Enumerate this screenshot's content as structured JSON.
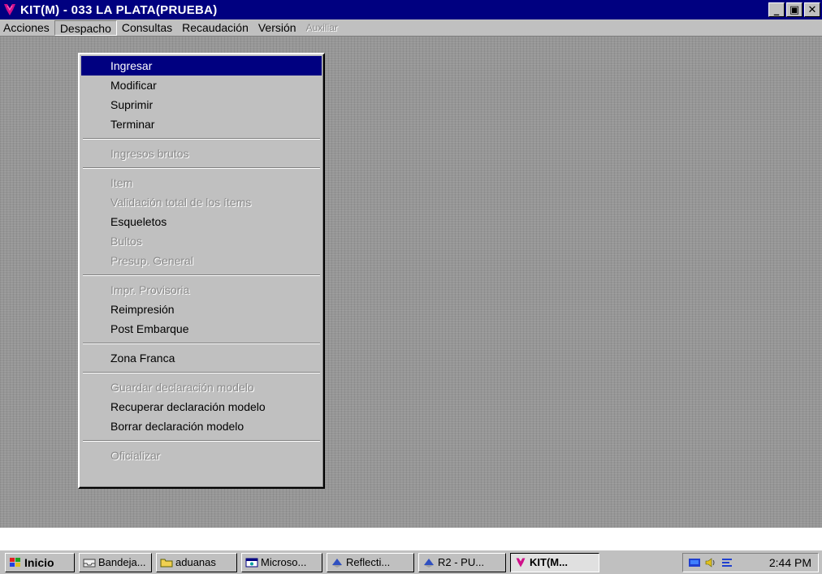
{
  "window": {
    "title": "KIT(M) - 033 LA PLATA(PRUEBA)"
  },
  "window_buttons": {
    "minimize": "_",
    "maximize": "▣",
    "close": "✕"
  },
  "menubar": [
    {
      "label": "Acciones",
      "state": "normal"
    },
    {
      "label": "Despacho",
      "state": "open"
    },
    {
      "label": "Consultas",
      "state": "normal"
    },
    {
      "label": "Recaudación",
      "state": "normal"
    },
    {
      "label": "Versión",
      "state": "normal"
    },
    {
      "label": "Auxiliar",
      "state": "disabled"
    }
  ],
  "dropdown": {
    "menu": "Despacho",
    "items": [
      {
        "label": "Ingresar",
        "enabled": true,
        "selected": true
      },
      {
        "label": "Modificar",
        "enabled": true
      },
      {
        "label": "Suprimir",
        "enabled": true
      },
      {
        "label": "Terminar",
        "enabled": true
      },
      {
        "label": "Ingresos brutos",
        "enabled": false
      },
      {
        "label": "Item",
        "enabled": false
      },
      {
        "label": "Validación total de los ítems",
        "enabled": false
      },
      {
        "label": "Esqueletos",
        "enabled": true
      },
      {
        "label": "Bultos",
        "enabled": false
      },
      {
        "label": "Presup. General",
        "enabled": false
      },
      {
        "label": "Impr. Provisoria",
        "enabled": false
      },
      {
        "label": "Reimpresión",
        "enabled": true
      },
      {
        "label": "Post Embarque",
        "enabled": true
      },
      {
        "label": "Zona Franca",
        "enabled": true
      },
      {
        "label": "Guardar declaración modelo",
        "enabled": false
      },
      {
        "label": "Recuperar declaración modelo",
        "enabled": true
      },
      {
        "label": "Borrar declaración modelo",
        "enabled": true
      },
      {
        "label": "Oficializar",
        "enabled": false
      }
    ]
  },
  "taskbar": {
    "start_label": "Inicio",
    "buttons": [
      {
        "label": "Bandeja...",
        "icon": "inbox-icon"
      },
      {
        "label": "aduanas",
        "icon": "folder-icon"
      },
      {
        "label": "Microso...",
        "icon": "window-app-icon"
      },
      {
        "label": "Reflecti...",
        "icon": "reflection-app-icon"
      },
      {
        "label": "R2 - PU...",
        "icon": "reflection-app-icon"
      },
      {
        "label": "KIT(M...",
        "icon": "kit-app-icon",
        "active": true
      }
    ],
    "clock": "2:44 PM"
  },
  "colors": {
    "titlebar": "#000080",
    "workspace": "#969696",
    "chrome": "#c0c0c0",
    "selection": "#000080",
    "app_icon": "#d0108a"
  }
}
